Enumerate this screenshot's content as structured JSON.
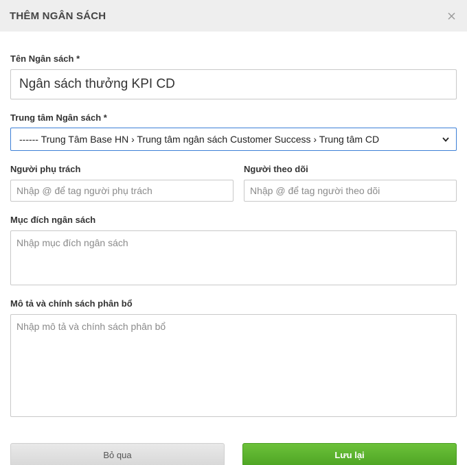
{
  "modal": {
    "title": "THÊM NGÂN SÁCH"
  },
  "form": {
    "name": {
      "label": "Tên Ngân sách *",
      "value": "Ngân sách thưởng KPI CD"
    },
    "center": {
      "label": "Trung tâm Ngân sách *",
      "selected": "------ Trung Tâm Base HN › Trung tâm ngân sách Customer Success › Trung tâm CD"
    },
    "owner": {
      "label": "Người phụ trách",
      "placeholder": "Nhập @ để tag người phụ trách"
    },
    "follower": {
      "label": "Người theo dõi",
      "placeholder": "Nhập @ để tag người theo dõi"
    },
    "purpose": {
      "label": "Mục đích ngân sách",
      "placeholder": "Nhập mục đích ngân sách"
    },
    "description": {
      "label": "Mô tả và chính sách phân bổ",
      "placeholder": "Nhập mô tả và chính sách phân bổ"
    }
  },
  "footer": {
    "cancel_label": "Bỏ qua",
    "save_label": "Lưu lại"
  },
  "icons": {
    "close": "close-icon",
    "dropdown": "chevron-down-icon"
  },
  "colors": {
    "header_bg": "#eeeeee",
    "select_border": "#3b7ed6",
    "save_button": "#57b02c",
    "cancel_button": "#e0e0e0"
  }
}
